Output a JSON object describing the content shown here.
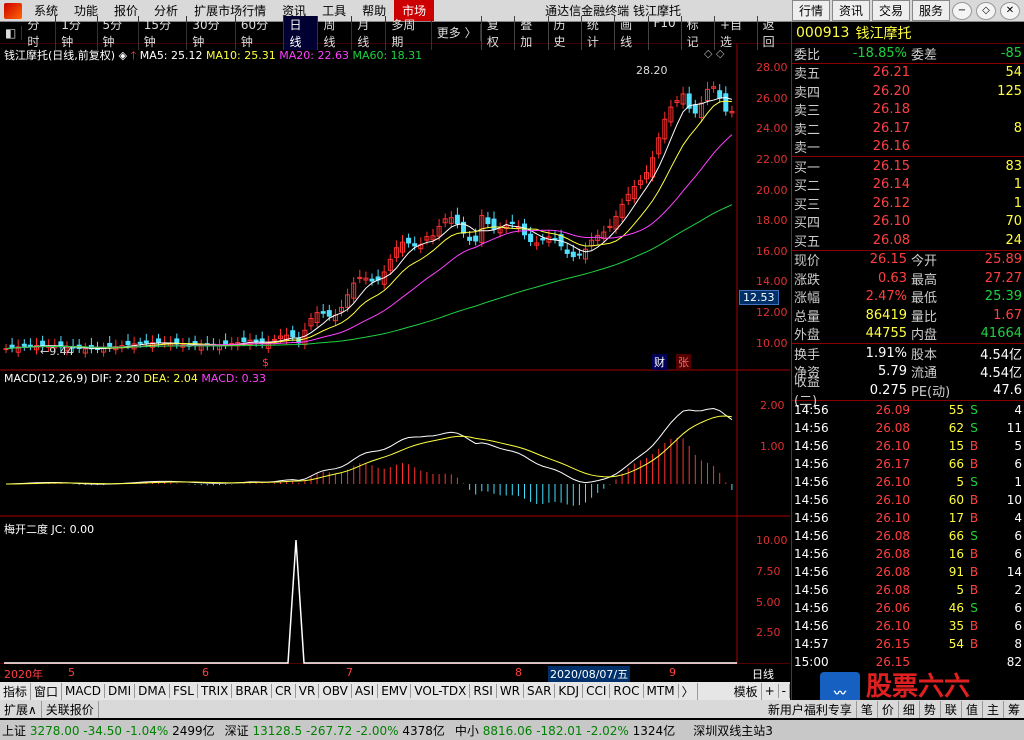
{
  "menu": {
    "items": [
      "系统",
      "功能",
      "报价",
      "分析",
      "扩展市场行情",
      "资讯",
      "工具",
      "帮助"
    ],
    "active": "市场",
    "title": "通达信金融终端  钱江摩托",
    "right_buttons": [
      "行情",
      "资讯",
      "交易",
      "服务"
    ]
  },
  "periods": {
    "items": [
      "分时",
      "1分钟",
      "5分钟",
      "15分钟",
      "30分钟",
      "60分钟",
      "日线",
      "周线",
      "月线",
      "多周期",
      "更多 〉"
    ],
    "selected": "日线",
    "right": [
      "复权",
      "叠加",
      "历史",
      "统计",
      "画线",
      "F10",
      "标记",
      "+自选",
      "返回"
    ]
  },
  "main_chart": {
    "title": "钱江摩托(日线,前复权)",
    "ma5": "MA5: 25.12",
    "ma10": "MA10: 25.31",
    "ma20": "MA20: 22.63",
    "ma60": "MA60: 18.31",
    "high_label": "28.20",
    "low_label": "9.44",
    "axis": [
      "28.00",
      "26.00",
      "24.00",
      "22.00",
      "20.00",
      "18.00",
      "16.00",
      "14.00",
      "12.00",
      "10.00"
    ],
    "current_price": "12.53",
    "badge1": "财",
    "badge2": "张",
    "marker": "$"
  },
  "macd": {
    "title": "MACD(12,26,9)",
    "dif": "DIF: 2.20",
    "dea": "DEA: 2.04",
    "macd": "MACD: 0.33",
    "axis": [
      "2.00",
      "1.00"
    ]
  },
  "mk": {
    "title": "梅开二度",
    "jc": "JC: 0.00",
    "axis": [
      "10.00",
      "7.50",
      "5.00",
      "2.50"
    ]
  },
  "timeaxis": {
    "labels": [
      "2020年",
      "5",
      "6",
      "7",
      "8",
      "9"
    ],
    "cursor": "2020/08/07/五",
    "period": "日线"
  },
  "quote": {
    "code": "000913",
    "name": "钱江摩托",
    "weibi": {
      "label": "委比",
      "value": "-18.85%",
      "label2": "委差",
      "value2": "-85"
    },
    "sells": [
      {
        "l": "卖五",
        "p": "26.21",
        "v": "54"
      },
      {
        "l": "卖四",
        "p": "26.20",
        "v": "125"
      },
      {
        "l": "卖三",
        "p": "26.18",
        "v": ""
      },
      {
        "l": "卖二",
        "p": "26.17",
        "v": "8"
      },
      {
        "l": "卖一",
        "p": "26.16",
        "v": ""
      }
    ],
    "buys": [
      {
        "l": "买一",
        "p": "26.15",
        "v": "83"
      },
      {
        "l": "买二",
        "p": "26.14",
        "v": "1"
      },
      {
        "l": "买三",
        "p": "26.12",
        "v": "1"
      },
      {
        "l": "买四",
        "p": "26.10",
        "v": "70"
      },
      {
        "l": "买五",
        "p": "26.08",
        "v": "24"
      }
    ],
    "stats": [
      {
        "l": "现价",
        "v": "26.15",
        "l2": "今开",
        "v2": "25.89"
      },
      {
        "l": "涨跌",
        "v": "0.63",
        "l2": "最高",
        "v2": "27.27"
      },
      {
        "l": "涨幅",
        "v": "2.47%",
        "l2": "最低",
        "v2": "25.39"
      },
      {
        "l": "总量",
        "v": "86419",
        "l2": "量比",
        "v2": "1.67"
      },
      {
        "l": "外盘",
        "v": "44755",
        "l2": "内盘",
        "v2": "41664"
      }
    ],
    "stats2": [
      {
        "l": "换手",
        "v": "1.91%",
        "l2": "股本",
        "v2": "4.54亿"
      },
      {
        "l": "净资",
        "v": "5.79",
        "l2": "流通",
        "v2": "4.54亿"
      },
      {
        "l": "收益(二)",
        "v": "0.275",
        "l2": "PE(动)",
        "v2": "47.6"
      }
    ],
    "ticks": [
      {
        "t": "14:56",
        "p": "26.09",
        "v": "55",
        "s": "S",
        "n": "4"
      },
      {
        "t": "14:56",
        "p": "26.08",
        "v": "62",
        "s": "S",
        "n": "11"
      },
      {
        "t": "14:56",
        "p": "26.10",
        "v": "15",
        "s": "B",
        "n": "5"
      },
      {
        "t": "14:56",
        "p": "26.17",
        "v": "66",
        "s": "B",
        "n": "6"
      },
      {
        "t": "14:56",
        "p": "26.10",
        "v": "5",
        "s": "S",
        "n": "1"
      },
      {
        "t": "14:56",
        "p": "26.10",
        "v": "60",
        "s": "B",
        "n": "10"
      },
      {
        "t": "14:56",
        "p": "26.10",
        "v": "17",
        "s": "B",
        "n": "4"
      },
      {
        "t": "14:56",
        "p": "26.08",
        "v": "66",
        "s": "S",
        "n": "6"
      },
      {
        "t": "14:56",
        "p": "26.08",
        "v": "16",
        "s": "B",
        "n": "6"
      },
      {
        "t": "14:56",
        "p": "26.08",
        "v": "91",
        "s": "B",
        "n": "14"
      },
      {
        "t": "14:56",
        "p": "26.08",
        "v": "5",
        "s": "B",
        "n": "2"
      },
      {
        "t": "14:56",
        "p": "26.06",
        "v": "46",
        "s": "S",
        "n": "6"
      },
      {
        "t": "14:56",
        "p": "26.10",
        "v": "35",
        "s": "B",
        "n": "6"
      },
      {
        "t": "14:57",
        "p": "26.15",
        "v": "54",
        "s": "B",
        "n": "8"
      },
      {
        "t": "15:00",
        "p": "26.15",
        "v": "",
        "s": "",
        "n": "82"
      }
    ]
  },
  "indicator_tabs": [
    "指标",
    "窗口",
    "MACD",
    "DMI",
    "DMA",
    "FSL",
    "TRIX",
    "BRAR",
    "CR",
    "VR",
    "OBV",
    "ASI",
    "EMV",
    "VOL-TDX",
    "RSI",
    "WR",
    "SAR",
    "KDJ",
    "CCI",
    "ROC",
    "MTM",
    "〉",
    "模板",
    "+",
    "-"
  ],
  "bottom": {
    "left1": "扩展∧",
    "left2": "关联报价",
    "right1": "新用户福利专享",
    "right_tabs": [
      "笔",
      "价",
      "细",
      "势",
      "联",
      "值",
      "主",
      "筹"
    ]
  },
  "status": {
    "sh": {
      "name": "上证",
      "v": "3278.00",
      "c": "-34.50",
      "p": "-1.04%",
      "amt": "2499亿"
    },
    "sz": {
      "name": "深证",
      "v": "13128.5",
      "c": "-267.72",
      "p": "-2.00%",
      "amt": "4378亿"
    },
    "zx": {
      "name": "中小",
      "v": "8816.06",
      "c": "-182.01",
      "p": "-2.02%",
      "amt": "1324亿"
    },
    "server": "深圳双线主站3"
  },
  "watermark": "股票六六",
  "watermark_url": "www.gp66.com"
}
